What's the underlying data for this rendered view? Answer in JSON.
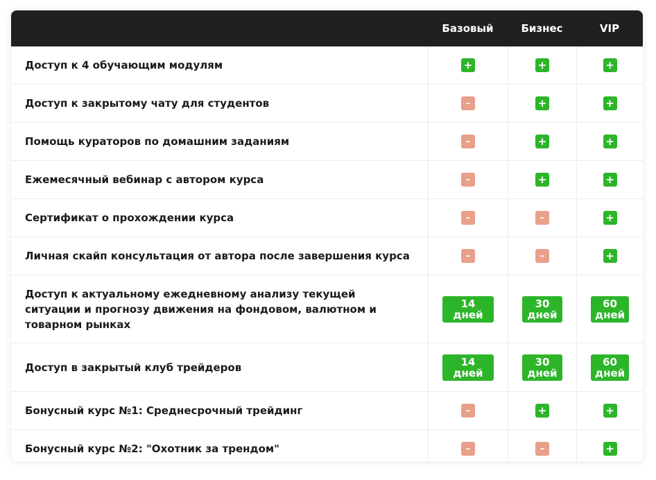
{
  "header": {
    "plans": [
      "Базовый",
      "Бизнес",
      "VIP"
    ]
  },
  "colors": {
    "header_bg": "#202020",
    "included": "#2db52a",
    "excluded": "#e8a08a"
  },
  "icons": {
    "included": "plus-icon",
    "excluded": "minus-icon",
    "included_glyph": "+",
    "excluded_glyph": "–"
  },
  "rows": [
    {
      "feature": "Доступ к 4 обучающим модулям",
      "values": [
        "+",
        "+",
        "+"
      ]
    },
    {
      "feature": "Доступ к закрытому чату для студентов",
      "values": [
        "-",
        "+",
        "+"
      ]
    },
    {
      "feature": "Помощь кураторов по домашним заданиям",
      "values": [
        "-",
        "+",
        "+"
      ]
    },
    {
      "feature": "Ежемесячный вебинар с автором курса",
      "values": [
        "-",
        "+",
        "+"
      ]
    },
    {
      "feature": "Сертификат о прохождении курса",
      "values": [
        "-",
        "-",
        "+"
      ]
    },
    {
      "feature": "Личная скайп консультация от автора после завершения курса",
      "values": [
        "-",
        "-",
        "+"
      ]
    },
    {
      "feature": "Доступ к актуальному ежедневному анализу текущей ситуации и прогнозу движения на фондовом, валютном и товарном рынках",
      "values": [
        {
          "num": "14",
          "unit": "дней"
        },
        {
          "num": "30",
          "unit": "дней"
        },
        {
          "num": "60",
          "unit": "дней"
        }
      ]
    },
    {
      "feature": "Доступ в закрытый клуб трейдеров",
      "values": [
        {
          "num": "14",
          "unit": "дней"
        },
        {
          "num": "30",
          "unit": "дней"
        },
        {
          "num": "60",
          "unit": "дней"
        }
      ]
    },
    {
      "feature": "Бонусный курс №1: Среднесрочный трейдинг",
      "values": [
        "-",
        "+",
        "+"
      ]
    },
    {
      "feature": "Бонусный курс №2: \"Охотник за трендом\"",
      "values": [
        "-",
        "-",
        "+"
      ]
    }
  ]
}
